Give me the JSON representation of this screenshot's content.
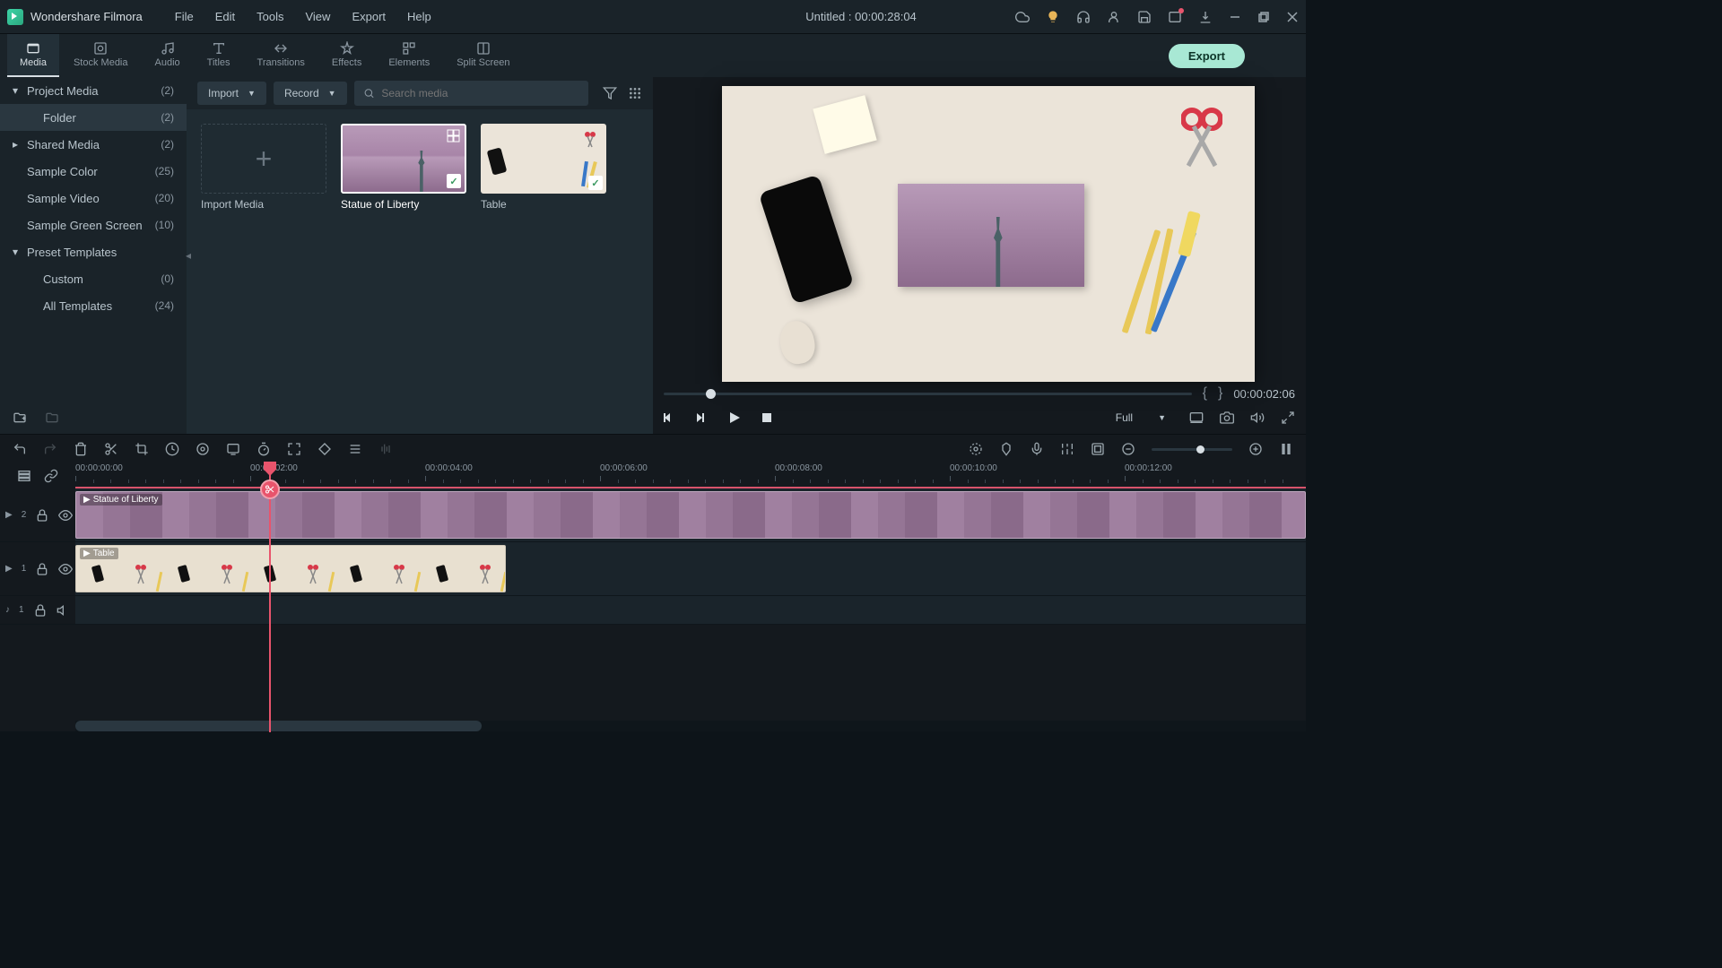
{
  "app_name": "Wondershare Filmora",
  "document_title": "Untitled : 00:00:28:04",
  "menus": [
    "File",
    "Edit",
    "Tools",
    "View",
    "Export",
    "Help"
  ],
  "tabs": [
    {
      "label": "Media",
      "active": true
    },
    {
      "label": "Stock Media",
      "active": false
    },
    {
      "label": "Audio",
      "active": false
    },
    {
      "label": "Titles",
      "active": false
    },
    {
      "label": "Transitions",
      "active": false
    },
    {
      "label": "Effects",
      "active": false
    },
    {
      "label": "Elements",
      "active": false
    },
    {
      "label": "Split Screen",
      "active": false
    }
  ],
  "export_label": "Export",
  "sidebar": [
    {
      "label": "Project Media",
      "count": "(2)",
      "chevron": "down",
      "indent": 0,
      "selected": false
    },
    {
      "label": "Folder",
      "count": "(2)",
      "chevron": "",
      "indent": 1,
      "selected": true
    },
    {
      "label": "Shared Media",
      "count": "(2)",
      "chevron": "right",
      "indent": 0,
      "selected": false
    },
    {
      "label": "Sample Color",
      "count": "(25)",
      "chevron": "",
      "indent": 0,
      "selected": false
    },
    {
      "label": "Sample Video",
      "count": "(20)",
      "chevron": "",
      "indent": 0,
      "selected": false
    },
    {
      "label": "Sample Green Screen",
      "count": "(10)",
      "chevron": "",
      "indent": 0,
      "selected": false
    },
    {
      "label": "Preset Templates",
      "count": "",
      "chevron": "down",
      "indent": 0,
      "selected": false
    },
    {
      "label": "Custom",
      "count": "(0)",
      "chevron": "",
      "indent": 1,
      "selected": false
    },
    {
      "label": "All Templates",
      "count": "(24)",
      "chevron": "",
      "indent": 1,
      "selected": false
    }
  ],
  "media_toolbar": {
    "import": "Import",
    "record": "Record",
    "search_placeholder": "Search media"
  },
  "media_items": {
    "import_label": "Import Media",
    "liberty": "Statue of Liberty",
    "table": "Table"
  },
  "preview": {
    "time": "00:00:02:06",
    "display": "Full"
  },
  "ruler_ticks": [
    "00:00:00:00",
    "00:00:02:00",
    "00:00:04:00",
    "00:00:06:00",
    "00:00:08:00",
    "00:00:10:00",
    "00:00:12:00"
  ],
  "tracks": {
    "v2": "2",
    "v1": "1",
    "a1": "1",
    "clip_liberty": "Statue of Liberty",
    "clip_table": "Table"
  }
}
